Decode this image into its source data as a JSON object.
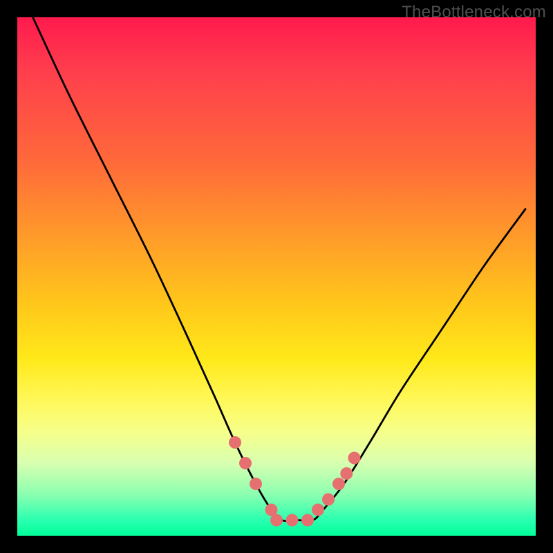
{
  "watermark": "TheBottleneck.com",
  "chart_data": {
    "type": "line",
    "title": "",
    "xlabel": "",
    "ylabel": "",
    "xlim": [
      0,
      100
    ],
    "ylim": [
      0,
      100
    ],
    "grid": false,
    "series": [
      {
        "name": "bottleneck-curve",
        "color": "#000000",
        "x": [
          3,
          10,
          18,
          26,
          33,
          38,
          42,
          46,
          49,
          51,
          54,
          57,
          59,
          63,
          68,
          74,
          82,
          90,
          98
        ],
        "y": [
          100,
          85,
          69,
          53,
          38,
          27,
          18,
          10,
          5,
          3,
          3,
          3,
          5,
          10,
          18,
          28,
          40,
          52,
          63
        ]
      }
    ],
    "markers": {
      "name": "highlighted-points",
      "color": "#e67070",
      "points": [
        {
          "x": 42,
          "y": 18
        },
        {
          "x": 44,
          "y": 14
        },
        {
          "x": 46,
          "y": 10
        },
        {
          "x": 49,
          "y": 5
        },
        {
          "x": 50,
          "y": 3
        },
        {
          "x": 53,
          "y": 3
        },
        {
          "x": 56,
          "y": 3
        },
        {
          "x": 58,
          "y": 5
        },
        {
          "x": 60,
          "y": 7
        },
        {
          "x": 62,
          "y": 10
        },
        {
          "x": 63.5,
          "y": 12
        },
        {
          "x": 65,
          "y": 15
        }
      ]
    },
    "gradient_colors": {
      "top": "#ff1a4d",
      "upper_mid": "#ff9a2a",
      "mid": "#ffe91a",
      "lower_mid": "#d8ffb0",
      "bottom": "#00ff9a"
    }
  }
}
